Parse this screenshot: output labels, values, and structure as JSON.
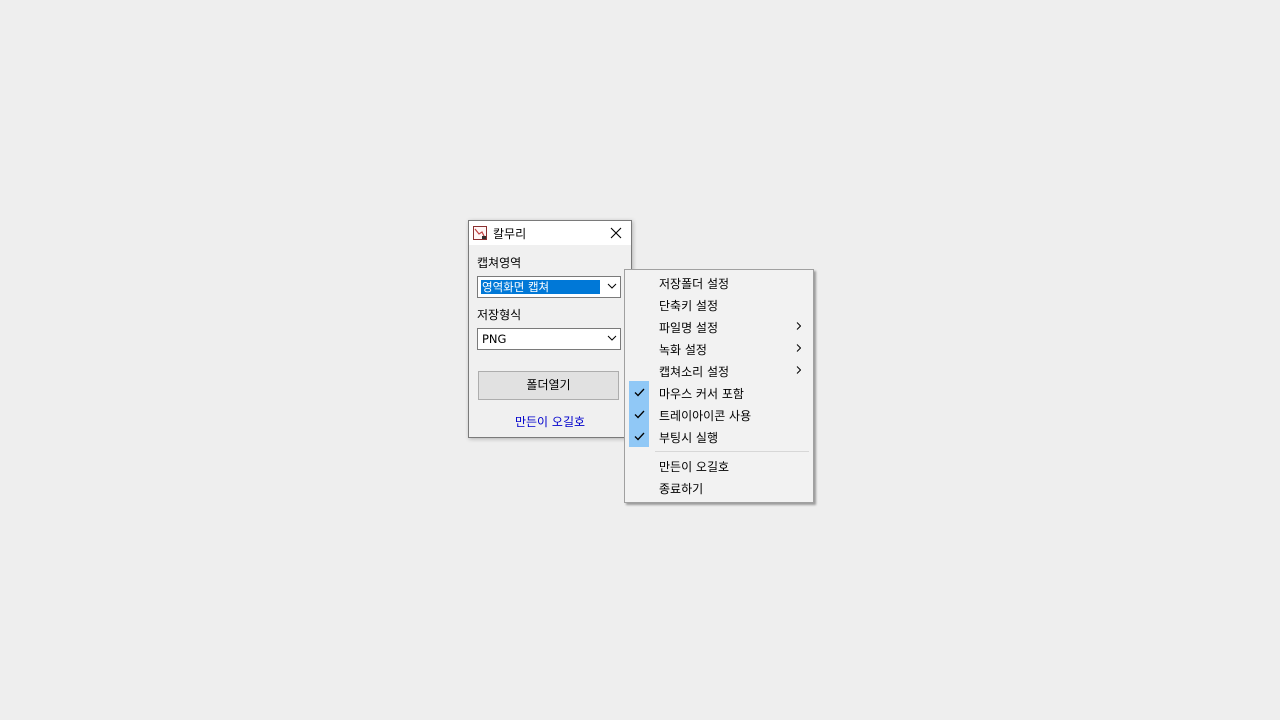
{
  "window": {
    "title": "칼무리",
    "capture_area_label": "캡쳐영역",
    "capture_area_value": "영역화면 캡쳐",
    "save_format_label": "저장형식",
    "save_format_value": "PNG",
    "open_folder_button": "폴더열기",
    "maker_link": "만든이 오길호"
  },
  "context_menu": {
    "items": [
      {
        "label": "저장폴더 설정",
        "checked": false,
        "submenu": false
      },
      {
        "label": "단축키 설정",
        "checked": false,
        "submenu": false
      },
      {
        "label": "파일명 설정",
        "checked": false,
        "submenu": true
      },
      {
        "label": "녹화 설정",
        "checked": false,
        "submenu": true
      },
      {
        "label": "캡쳐소리 설정",
        "checked": false,
        "submenu": true
      },
      {
        "label": "마우스 커서 포함",
        "checked": true,
        "submenu": false
      },
      {
        "label": "트레이아이콘 사용",
        "checked": true,
        "submenu": false
      },
      {
        "label": "부팅시 실행",
        "checked": true,
        "submenu": false
      },
      {
        "label": "만든이 오길호",
        "checked": false,
        "submenu": false
      },
      {
        "label": "종료하기",
        "checked": false,
        "submenu": false
      }
    ]
  },
  "colors": {
    "selection": "#0078d7",
    "check_highlight": "#90c8f6",
    "link": "#0000cc"
  }
}
